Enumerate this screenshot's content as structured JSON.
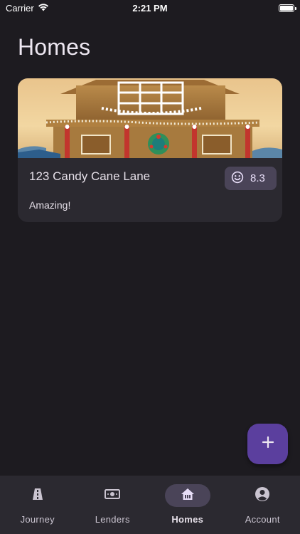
{
  "status_bar": {
    "carrier": "Carrier",
    "time": "2:21 PM"
  },
  "page": {
    "title": "Homes"
  },
  "homes": [
    {
      "address": "123 Candy Cane Lane",
      "score": "8.3",
      "note": "Amazing!",
      "image_icon": "gingerbread-house-photo",
      "score_icon": "smiley-icon"
    }
  ],
  "fab": {
    "icon": "plus-icon"
  },
  "nav": {
    "items": [
      {
        "label": "Journey",
        "icon": "road-icon",
        "active": false
      },
      {
        "label": "Lenders",
        "icon": "money-icon",
        "active": false
      },
      {
        "label": "Homes",
        "icon": "house-icon",
        "active": true
      },
      {
        "label": "Account",
        "icon": "account-circle-icon",
        "active": false
      }
    ]
  },
  "colors": {
    "background": "#1d1b20",
    "card": "#2b2930",
    "chip": "#4a4458",
    "fab": "#5b3f9e",
    "on_surface": "#e6e0e9"
  }
}
